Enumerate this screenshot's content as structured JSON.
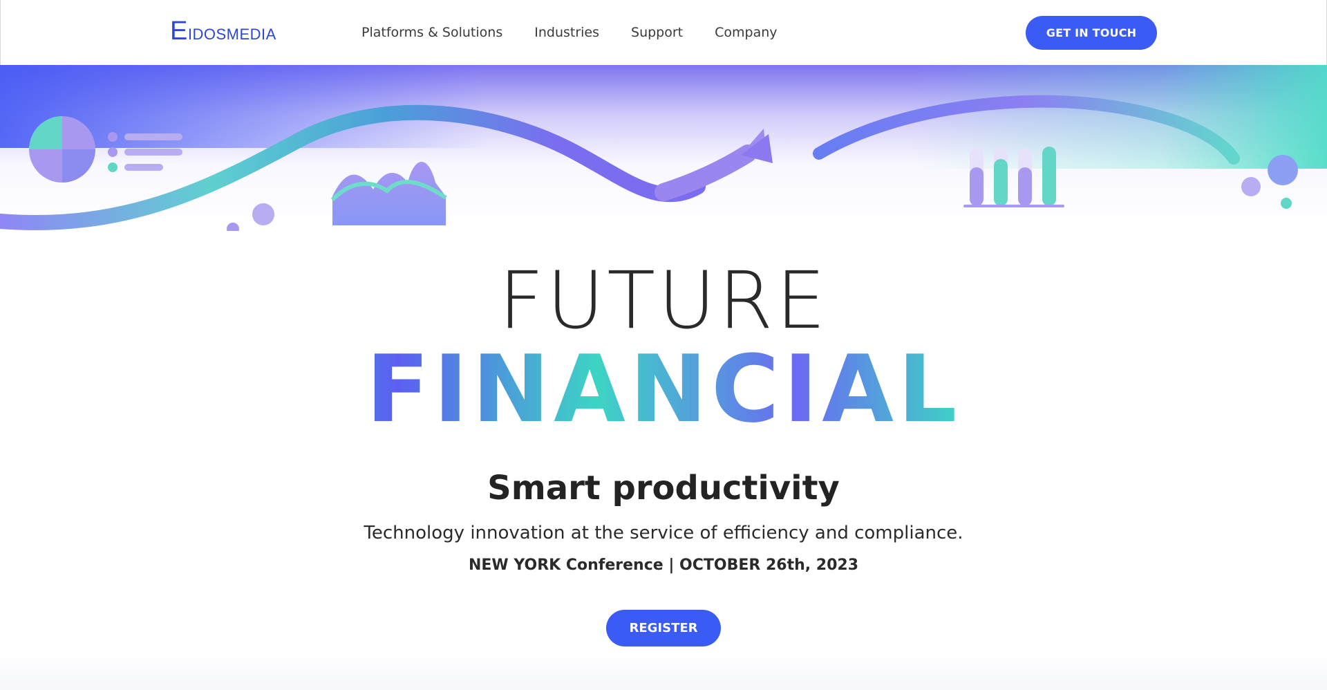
{
  "nav": {
    "logo_text": "EIDOSMEDIA",
    "menu": [
      {
        "label": "Platforms & Solutions"
      },
      {
        "label": "Industries"
      },
      {
        "label": "Support"
      },
      {
        "label": "Company"
      }
    ],
    "cta_label": "GET IN TOUCH"
  },
  "hero": {
    "line1": "FUTURE",
    "line2": "FINANCIAL",
    "heading": "Smart productivity",
    "subtitle": "Technology innovation at the service of efficiency and compliance.",
    "event": "NEW YORK Conference | OCTOBER 26th, 2023",
    "register_label": "REGISTER"
  },
  "colors": {
    "brand_blue": "#3b5bf5",
    "logo_blue": "#2d46d8",
    "accent_purple": "#8a70ee",
    "accent_teal": "#4dd6c6"
  },
  "icons": [
    "pie-chart-icon",
    "list-icon",
    "area-chart-icon",
    "arrow-icon",
    "bar-chart-icon"
  ]
}
